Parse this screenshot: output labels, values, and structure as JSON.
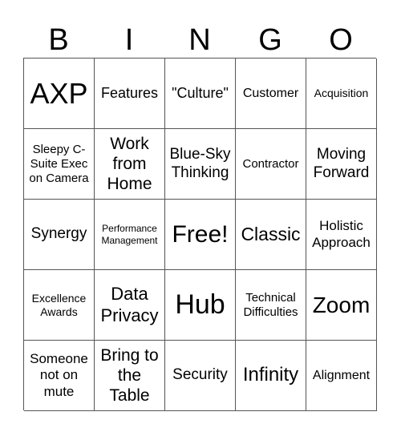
{
  "header": [
    "B",
    "I",
    "N",
    "G",
    "O"
  ],
  "cells": [
    "AXP",
    "Features",
    "\"Culture\"",
    "Customer",
    "Acquisition",
    "Sleepy C-Suite Exec on Camera",
    "Work from Home",
    "Blue-Sky Thinking",
    "Contractor",
    "Moving Forward",
    "Synergy",
    "Performance Management",
    "Free!",
    "Classic",
    "Holistic Approach",
    "Excellence Awards",
    "Data Privacy",
    "Hub",
    "Technical Difficulties",
    "Zoom",
    "Someone not on mute",
    "Bring to the Table",
    "Security",
    "Infinity",
    "Alignment"
  ]
}
